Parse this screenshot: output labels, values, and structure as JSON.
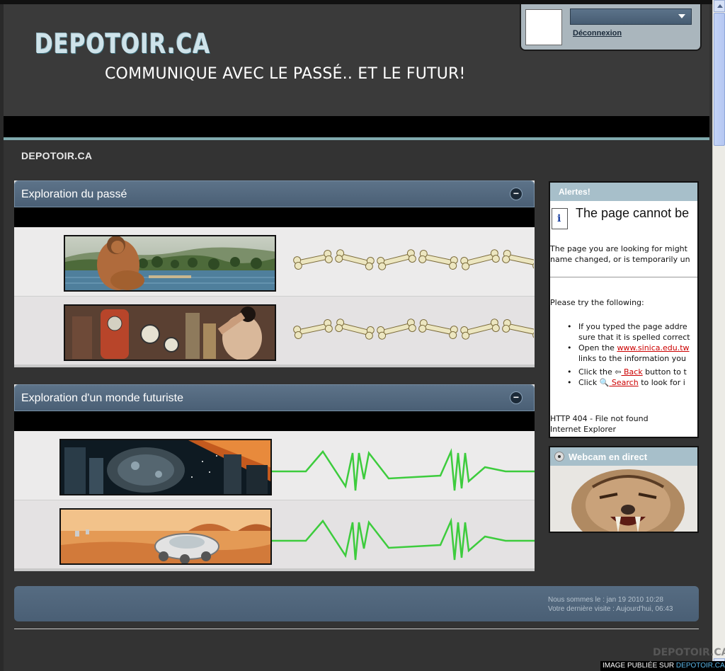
{
  "header": {
    "logo": "DEPOTOIR.CA",
    "tagline": "COMMUNIQUE AVEC LE PASSÉ.. ET LE FUTUR!"
  },
  "userbox": {
    "select_value": "",
    "logout_label": "Déconnexion"
  },
  "breadcrumb": "DEPOTOIR.CA",
  "categories": [
    {
      "title": "Exploration du passé",
      "toggle": "−"
    },
    {
      "title": "Exploration d'un monde futuriste",
      "toggle": "−"
    }
  ],
  "alert_box": {
    "title": "Alertes!",
    "page_title": "The page cannot be",
    "para1_line1": "The page you are looking for might",
    "para1_line2": "name changed, or is temporarily un",
    "para2": "Please try the following:",
    "items": [
      {
        "l1": "If you typed the page addre",
        "l2": "sure that it is spelled correct"
      },
      {
        "l1_pre": "Open the ",
        "link": "www.sinica.edu.tw",
        "l2": "links to the information you"
      },
      {
        "pre": "Click the ⇦",
        "link": " Back",
        "post": " button to t"
      },
      {
        "pre": "Click 🔍",
        "link": " Search",
        "post": " to look for i"
      }
    ],
    "foot1": "HTTP 404 - File not found",
    "foot2": "Internet Explorer"
  },
  "webcam_box": {
    "title": "Webcam en direct"
  },
  "stats": {
    "now": "Nous sommes le : jan 19 2010 10:28",
    "last_visit": "Votre dernière visite : Aujourd'hui, 06:43"
  },
  "watermark": {
    "prefix": "IMAGE PUBLIÉE SUR ",
    "site": "DEPOTOIR.CA",
    "logo": "DEPOTOIR.CA"
  },
  "colors": {
    "header_bg": "#3a3a3a",
    "panel_head": "#4a5f75",
    "accent_teal": "#7fa9ad",
    "ekg_green": "#3dcc3d",
    "bone": "#ece6c0"
  },
  "icons": [
    "chevron-down-icon",
    "collapse-icon",
    "document-info-icon",
    "webcam-icon",
    "back-arrow-icon",
    "search-icon"
  ]
}
